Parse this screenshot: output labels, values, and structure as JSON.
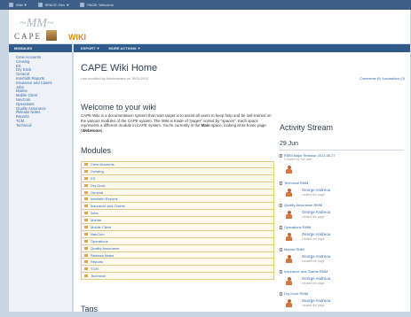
{
  "topbar": {
    "items": [
      "Wiki ▼",
      "SPACE: Dev ▼",
      "PAGE: Welcome"
    ]
  },
  "header": {
    "wiki_logo": "WIKI",
    "cape_logo": "CAPE"
  },
  "sidebar": {
    "heading": "MODULES",
    "items": [
      "Crew Accounts",
      "Crewing",
      "ES",
      "Dry Dock",
      "General",
      "Interfaith Reports",
      "Insurance and Claims",
      "Jobs",
      "Marine",
      "Mobile Client",
      "NavCom",
      "Operations",
      "Quality Assurance",
      "Release Notes",
      "Reports",
      "TCM",
      "Technical"
    ]
  },
  "subbar": {
    "items": [
      "EXPORT ▼",
      "MORE ACTIONS ▼"
    ]
  },
  "main": {
    "title": "CAPE Wiki Home",
    "last_modified": "Last modified by Administrator on 15/01/2013",
    "meta_links": "Comments (0)   Annotations (0)",
    "welcome_heading": "Welcome to your wiki",
    "para_1": "CAPE Wiki is a documentation system that main target is to assist all users to keep help and be self-trained on the various modules of the CAPE system. The Wiki is made of \"pages\" sorted by \"spaces\". Each space represents a different module in CAPE system. You're currently in the",
    "para_space": "Main",
    "para_2": "space, looking at its home page (",
    "para_home": "WebHome",
    "para_3": ").",
    "modules_heading": "Modules",
    "modules": [
      "Crew Accounts",
      "Crewing",
      "ES",
      "Dry Dock",
      "General",
      "Interfaith Reports",
      "Insurance and Claims",
      "Jobs",
      "Marine",
      "Mobile Client",
      "NavCom",
      "Operations",
      "Quality Assurance",
      "Release Notes",
      "Reports",
      "TCM",
      "Technical"
    ],
    "tags_heading": "Tags"
  },
  "activity": {
    "heading": "Activity Stream",
    "date": "29 Jun",
    "items": [
      {
        "title": "RMM Major Release 2013.06.27",
        "sub": "Created by the user",
        "user": "",
        "action": ""
      },
      {
        "title": "Technical RMM",
        "user": "George Andreou",
        "action": "created the page"
      },
      {
        "title": "Quality Assurance RMM",
        "user": "George Andreou",
        "action": "created the page"
      },
      {
        "title": "Operations RMM",
        "user": "George Andreou",
        "action": "created the page"
      },
      {
        "title": "Marine RMM",
        "user": "George Andreou",
        "action": "created the page"
      },
      {
        "title": "Insurance and Claims RMM",
        "user": "George Andreou",
        "action": "created the page"
      },
      {
        "title": "Dry Dock RMM",
        "user": "George Andreou",
        "action": "created the page"
      }
    ]
  },
  "colors": {
    "topbar": "#3d5e86",
    "nav_blue": "#2f5a8a",
    "link": "#3366aa",
    "module_border": "#e9c887",
    "wiki_orange": "#d98a1a"
  }
}
